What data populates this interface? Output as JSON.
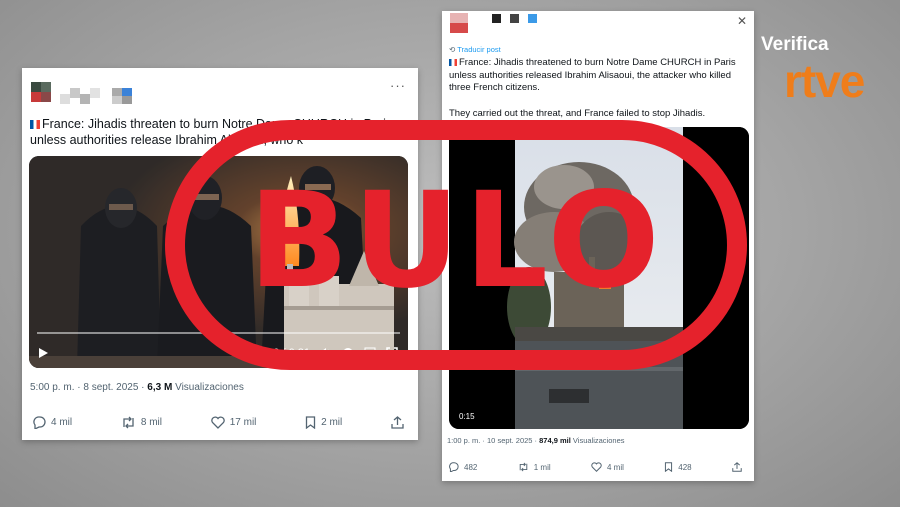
{
  "brand": {
    "top": "Verifica",
    "bottom": "rtve"
  },
  "stamp": "BULO",
  "tweet_left": {
    "text": "France: Jihadis threaten to burn Notre Dame CHURCH in Paris unless authorities release Ibrahim Alisaoui, who k",
    "video_time": "0:00 / 0:31",
    "timestamp": "5:00 p. m. · 8 sept. 2025 · ",
    "views": "6,3 M",
    "views_label": " Visualizaciones",
    "replies": "4 mil",
    "reposts": "8 mil",
    "likes": "17 mil",
    "bookmarks": "2 mil"
  },
  "tweet_right": {
    "translate": "Traducir post",
    "text1": "France: Jihadis threatened to burn Notre Dame CHURCH in Paris unless authorities released Ibrahim Alisaoui, the attacker who killed three French citizens.",
    "text2": "They carried out the threat, and France failed to stop Jihadis.",
    "video_time": "0:15",
    "timestamp": "1:00 p. m. · 10 sept. 2025 · ",
    "views": "874,9 mil",
    "views_label": " Visualizaciones",
    "replies": "482",
    "reposts": "1 mil",
    "likes": "4 mil",
    "bookmarks": "428"
  },
  "icons": [
    "flag-france-icon",
    "more-icon",
    "play-icon",
    "volume-icon",
    "settings-icon",
    "pip-icon",
    "fullscreen-icon",
    "reply-icon",
    "repost-icon",
    "like-icon",
    "bookmark-icon",
    "share-icon",
    "translate-icon"
  ],
  "colors": {
    "stamp_red": "#e5222c",
    "rtve_orange": "#ef7d1a"
  }
}
